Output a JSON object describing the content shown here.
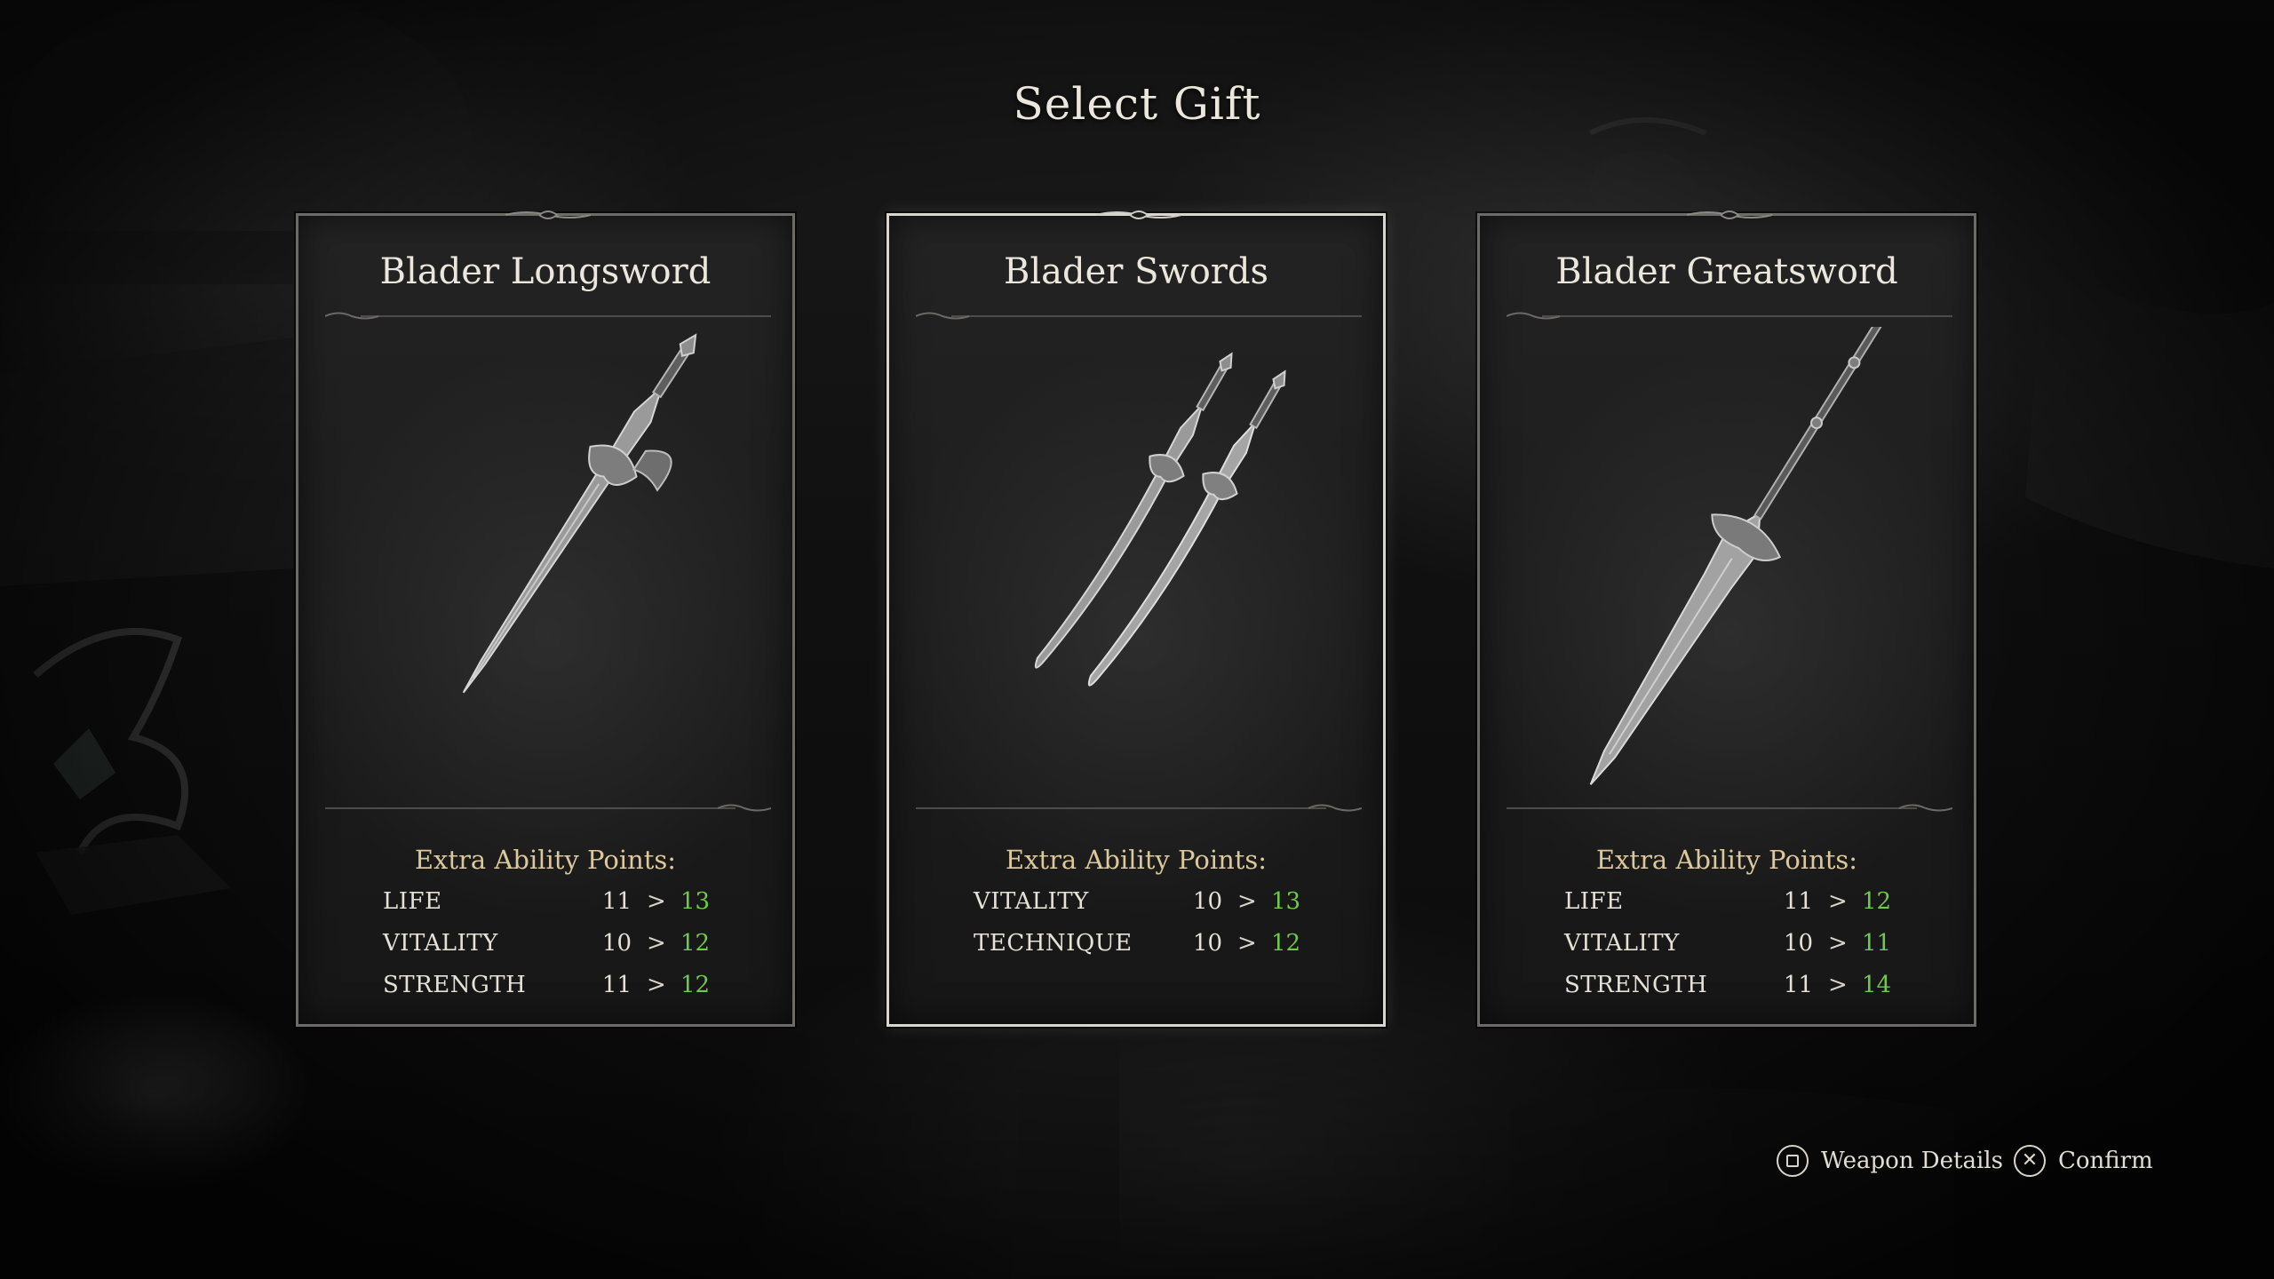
{
  "screen": {
    "title": "Select Gift"
  },
  "cards": [
    {
      "name": "Blader Longsword",
      "weapon_icon": "longsword-icon",
      "stats_header": "Extra Ability Points:",
      "stats": [
        {
          "label": "LIFE",
          "from": "11",
          "arrow": ">",
          "to": "13"
        },
        {
          "label": "VITALITY",
          "from": "10",
          "arrow": ">",
          "to": "12"
        },
        {
          "label": "STRENGTH",
          "from": "11",
          "arrow": ">",
          "to": "12"
        }
      ]
    },
    {
      "name": "Blader Swords",
      "weapon_icon": "dual-swords-icon",
      "stats_header": "Extra Ability Points:",
      "selected": true,
      "stats": [
        {
          "label": "VITALITY",
          "from": "10",
          "arrow": ">",
          "to": "13"
        },
        {
          "label": "TECHNIQUE",
          "from": "10",
          "arrow": ">",
          "to": "12"
        }
      ]
    },
    {
      "name": "Blader Greatsword",
      "weapon_icon": "greatsword-icon",
      "stats_header": "Extra Ability Points:",
      "stats": [
        {
          "label": "LIFE",
          "from": "11",
          "arrow": ">",
          "to": "12"
        },
        {
          "label": "VITALITY",
          "from": "10",
          "arrow": ">",
          "to": "11"
        },
        {
          "label": "STRENGTH",
          "from": "11",
          "arrow": ">",
          "to": "14"
        }
      ]
    }
  ],
  "prompts": {
    "details": {
      "label": "Weapon Details",
      "icon": "square-button-icon"
    },
    "confirm": {
      "label": "Confirm",
      "icon": "cross-button-icon"
    }
  },
  "colors": {
    "stat_increase": "#6fc94a",
    "header_gold": "#dcc89a",
    "selected_border": "#d8d6cf",
    "card_border": "#6c6b67"
  }
}
